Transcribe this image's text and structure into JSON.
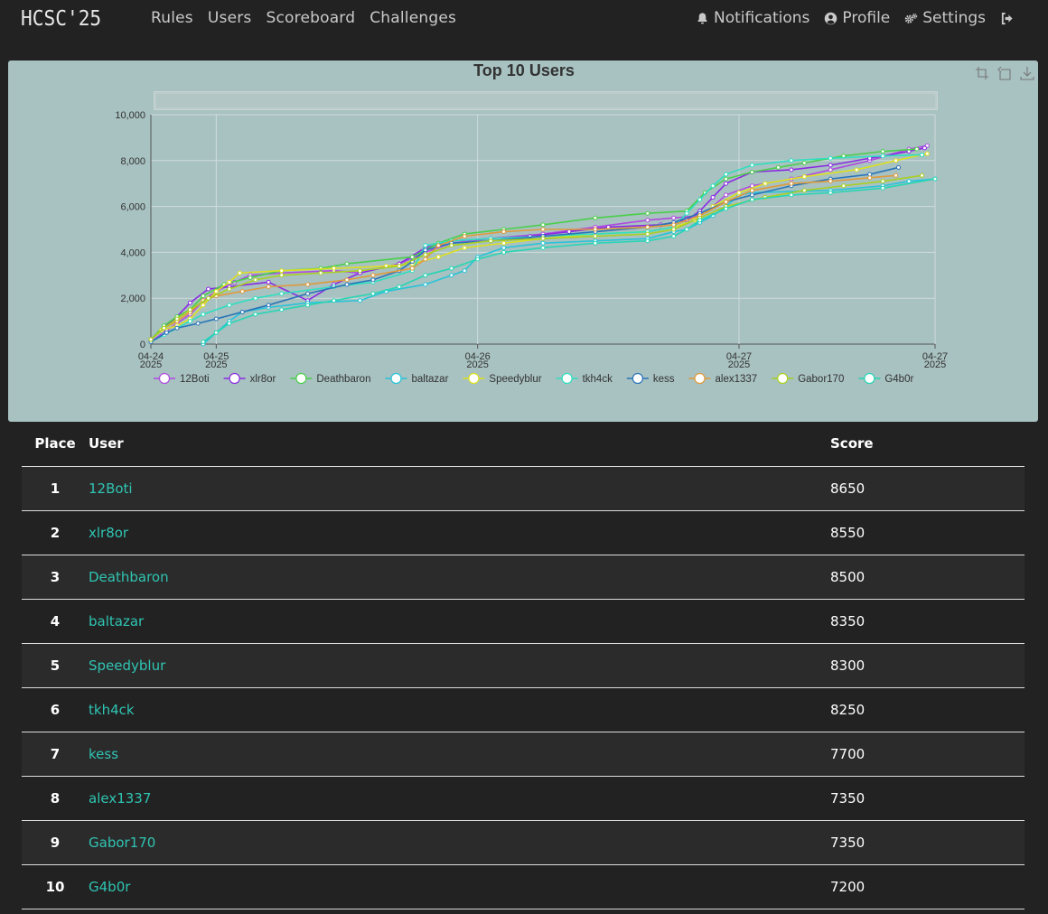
{
  "nav": {
    "brand": "HCSC'25",
    "links": [
      "Rules",
      "Users",
      "Scoreboard",
      "Challenges"
    ],
    "notifications": "Notifications",
    "profile": "Profile",
    "settings": "Settings"
  },
  "colors": {
    "accent": "#2fc4b2",
    "chart_bg": "#a8c1c1",
    "page_bg": "#222222"
  },
  "chart_data": {
    "type": "line",
    "title": "Top 10 Users",
    "y_ticks": [
      "0",
      "2,000",
      "4,000",
      "6,000",
      "8,000",
      "10,000"
    ],
    "ylim": [
      0,
      10000
    ],
    "x_ticks": [
      {
        "label": "04-24",
        "sub": "2025",
        "t": 0
      },
      {
        "label": "04-25",
        "sub": "2025",
        "t": 0.25
      },
      {
        "label": "04-26",
        "sub": "2025",
        "t": 1.25
      },
      {
        "label": "04-27",
        "sub": "2025",
        "t": 2.25
      },
      {
        "label": "04-27",
        "sub": "2025",
        "t": 3.0
      }
    ],
    "series": [
      {
        "name": "12Boti",
        "color": "#b04be0",
        "points": [
          [
            0,
            100
          ],
          [
            0.06,
            600
          ],
          [
            0.1,
            900
          ],
          [
            0.15,
            1300
          ],
          [
            0.2,
            1900
          ],
          [
            0.25,
            2300
          ],
          [
            0.32,
            2700
          ],
          [
            0.38,
            3000
          ],
          [
            0.5,
            3100
          ],
          [
            0.7,
            3200
          ],
          [
            0.8,
            3100
          ],
          [
            0.95,
            3500
          ],
          [
            1.05,
            4000
          ],
          [
            1.15,
            4400
          ],
          [
            1.3,
            4600
          ],
          [
            1.5,
            4800
          ],
          [
            1.7,
            5100
          ],
          [
            1.9,
            5400
          ],
          [
            2.0,
            5500
          ],
          [
            2.1,
            5600
          ],
          [
            2.15,
            6000
          ],
          [
            2.2,
            6500
          ],
          [
            2.3,
            6900
          ],
          [
            2.45,
            7200
          ],
          [
            2.6,
            7600
          ],
          [
            2.75,
            8000
          ],
          [
            2.9,
            8500
          ],
          [
            2.97,
            8650
          ]
        ]
      },
      {
        "name": "xlr8or",
        "color": "#8a2be2",
        "points": [
          [
            0,
            200
          ],
          [
            0.05,
            700
          ],
          [
            0.1,
            1200
          ],
          [
            0.15,
            1800
          ],
          [
            0.22,
            2400
          ],
          [
            0.3,
            2500
          ],
          [
            0.45,
            2700
          ],
          [
            0.6,
            1900
          ],
          [
            0.7,
            2600
          ],
          [
            0.8,
            3100
          ],
          [
            0.95,
            3500
          ],
          [
            1.05,
            4200
          ],
          [
            1.15,
            4500
          ],
          [
            1.3,
            4600
          ],
          [
            1.45,
            4700
          ],
          [
            1.6,
            4900
          ],
          [
            1.75,
            5100
          ],
          [
            1.95,
            5200
          ],
          [
            2.05,
            5400
          ],
          [
            2.1,
            5800
          ],
          [
            2.15,
            6400
          ],
          [
            2.2,
            7000
          ],
          [
            2.3,
            7500
          ],
          [
            2.45,
            7600
          ],
          [
            2.6,
            7800
          ],
          [
            2.75,
            8100
          ],
          [
            2.9,
            8400
          ],
          [
            2.96,
            8550
          ]
        ]
      },
      {
        "name": "Deathbaron",
        "color": "#4bcf4b",
        "points": [
          [
            0,
            200
          ],
          [
            0.05,
            800
          ],
          [
            0.1,
            1200
          ],
          [
            0.15,
            1500
          ],
          [
            0.2,
            2100
          ],
          [
            0.28,
            2600
          ],
          [
            0.38,
            2900
          ],
          [
            0.5,
            3200
          ],
          [
            0.65,
            3300
          ],
          [
            0.75,
            3500
          ],
          [
            1.0,
            3800
          ],
          [
            1.1,
            4400
          ],
          [
            1.2,
            4800
          ],
          [
            1.35,
            5000
          ],
          [
            1.5,
            5200
          ],
          [
            1.7,
            5500
          ],
          [
            1.9,
            5700
          ],
          [
            2.05,
            5800
          ],
          [
            2.12,
            6600
          ],
          [
            2.2,
            7200
          ],
          [
            2.3,
            7500
          ],
          [
            2.4,
            7700
          ],
          [
            2.5,
            7900
          ],
          [
            2.65,
            8200
          ],
          [
            2.8,
            8400
          ],
          [
            2.93,
            8500
          ]
        ]
      },
      {
        "name": "baltazar",
        "color": "#26c4d8",
        "points": [
          [
            0.2,
            0
          ],
          [
            0.25,
            500
          ],
          [
            0.3,
            1000
          ],
          [
            0.35,
            1400
          ],
          [
            0.45,
            1600
          ],
          [
            0.6,
            1800
          ],
          [
            0.8,
            1900
          ],
          [
            0.9,
            2300
          ],
          [
            1.05,
            2600
          ],
          [
            1.15,
            3000
          ],
          [
            1.2,
            3200
          ],
          [
            1.25,
            3800
          ],
          [
            1.35,
            4200
          ],
          [
            1.5,
            4400
          ],
          [
            1.7,
            4500
          ],
          [
            1.9,
            4600
          ],
          [
            2.0,
            4900
          ],
          [
            2.05,
            5000
          ],
          [
            2.1,
            5300
          ],
          [
            2.15,
            5600
          ],
          [
            2.2,
            6000
          ],
          [
            2.25,
            6500
          ],
          [
            2.3,
            6600
          ],
          [
            2.6,
            6700
          ],
          [
            2.8,
            6900
          ],
          [
            2.9,
            7100
          ],
          [
            3.0,
            7200
          ]
        ]
      },
      {
        "name": "Speedyblur",
        "color": "#dde021",
        "points": [
          [
            0,
            200
          ],
          [
            0.04,
            600
          ],
          [
            0.1,
            800
          ],
          [
            0.15,
            1100
          ],
          [
            0.2,
            1700
          ],
          [
            0.25,
            2300
          ],
          [
            0.3,
            2700
          ],
          [
            0.34,
            3100
          ],
          [
            0.5,
            3200
          ],
          [
            0.7,
            3300
          ],
          [
            0.9,
            3400
          ],
          [
            1.0,
            3500
          ],
          [
            1.1,
            3800
          ],
          [
            1.2,
            4200
          ],
          [
            1.35,
            4400
          ],
          [
            1.5,
            4600
          ],
          [
            1.7,
            4800
          ],
          [
            1.9,
            4900
          ],
          [
            2.0,
            5100
          ],
          [
            2.08,
            5400
          ],
          [
            2.15,
            6000
          ],
          [
            2.25,
            6600
          ],
          [
            2.35,
            7000
          ],
          [
            2.5,
            7300
          ],
          [
            2.7,
            7600
          ],
          [
            2.85,
            8000
          ],
          [
            2.97,
            8300
          ]
        ]
      },
      {
        "name": "tkh4ck",
        "color": "#2de0c0",
        "points": [
          [
            0,
            100
          ],
          [
            0.05,
            400
          ],
          [
            0.1,
            700
          ],
          [
            0.15,
            1000
          ],
          [
            0.2,
            1300
          ],
          [
            0.3,
            1700
          ],
          [
            0.4,
            2000
          ],
          [
            0.5,
            2200
          ],
          [
            0.7,
            2500
          ],
          [
            0.85,
            2700
          ],
          [
            1.0,
            3200
          ],
          [
            1.05,
            4300
          ],
          [
            1.15,
            4500
          ],
          [
            1.3,
            4600
          ],
          [
            1.5,
            4700
          ],
          [
            1.7,
            4800
          ],
          [
            1.9,
            4900
          ],
          [
            2.0,
            5100
          ],
          [
            2.05,
            5700
          ],
          [
            2.1,
            6300
          ],
          [
            2.15,
            6900
          ],
          [
            2.2,
            7400
          ],
          [
            2.3,
            7800
          ],
          [
            2.45,
            8000
          ],
          [
            2.6,
            8100
          ],
          [
            2.8,
            8200
          ],
          [
            2.95,
            8250
          ]
        ]
      },
      {
        "name": "kess",
        "color": "#2a74b8",
        "points": [
          [
            0,
            100
          ],
          [
            0.06,
            500
          ],
          [
            0.1,
            700
          ],
          [
            0.18,
            900
          ],
          [
            0.25,
            1100
          ],
          [
            0.35,
            1400
          ],
          [
            0.45,
            1700
          ],
          [
            0.6,
            2200
          ],
          [
            0.75,
            2600
          ],
          [
            0.85,
            2800
          ],
          [
            0.95,
            3200
          ],
          [
            1.0,
            3600
          ],
          [
            1.05,
            4100
          ],
          [
            1.15,
            4400
          ],
          [
            1.3,
            4500
          ],
          [
            1.5,
            4700
          ],
          [
            1.7,
            4900
          ],
          [
            1.9,
            5100
          ],
          [
            2.0,
            5300
          ],
          [
            2.1,
            5700
          ],
          [
            2.2,
            6200
          ],
          [
            2.3,
            6500
          ],
          [
            2.45,
            6900
          ],
          [
            2.6,
            7200
          ],
          [
            2.75,
            7400
          ],
          [
            2.86,
            7700
          ]
        ]
      },
      {
        "name": "alex1337",
        "color": "#e09a3a",
        "points": [
          [
            0,
            200
          ],
          [
            0.05,
            700
          ],
          [
            0.1,
            1000
          ],
          [
            0.15,
            1400
          ],
          [
            0.2,
            1900
          ],
          [
            0.25,
            2100
          ],
          [
            0.35,
            2300
          ],
          [
            0.45,
            2500
          ],
          [
            0.6,
            2600
          ],
          [
            0.75,
            2800
          ],
          [
            0.85,
            3000
          ],
          [
            1.0,
            3300
          ],
          [
            1.05,
            3700
          ],
          [
            1.1,
            4300
          ],
          [
            1.2,
            4700
          ],
          [
            1.35,
            4900
          ],
          [
            1.5,
            5000
          ],
          [
            1.7,
            5000
          ],
          [
            1.9,
            5100
          ],
          [
            2.0,
            5200
          ],
          [
            2.1,
            5600
          ],
          [
            2.2,
            6200
          ],
          [
            2.3,
            6700
          ],
          [
            2.45,
            7000
          ],
          [
            2.6,
            7100
          ],
          [
            2.75,
            7250
          ],
          [
            2.85,
            7350
          ]
        ]
      },
      {
        "name": "Gabor170",
        "color": "#a8d020",
        "points": [
          [
            0,
            200
          ],
          [
            0.05,
            700
          ],
          [
            0.1,
            1100
          ],
          [
            0.15,
            1500
          ],
          [
            0.22,
            2000
          ],
          [
            0.3,
            2400
          ],
          [
            0.4,
            2800
          ],
          [
            0.5,
            3000
          ],
          [
            0.65,
            3100
          ],
          [
            0.8,
            3200
          ],
          [
            0.95,
            3400
          ],
          [
            1.05,
            3900
          ],
          [
            1.15,
            4300
          ],
          [
            1.3,
            4500
          ],
          [
            1.5,
            4600
          ],
          [
            1.7,
            4700
          ],
          [
            1.9,
            4800
          ],
          [
            2.0,
            5000
          ],
          [
            2.1,
            5500
          ],
          [
            2.2,
            6000
          ],
          [
            2.35,
            6400
          ],
          [
            2.5,
            6700
          ],
          [
            2.65,
            6900
          ],
          [
            2.8,
            7100
          ],
          [
            2.95,
            7350
          ]
        ]
      },
      {
        "name": "G4b0r",
        "color": "#26d6b4",
        "points": [
          [
            0.2,
            100
          ],
          [
            0.25,
            500
          ],
          [
            0.3,
            900
          ],
          [
            0.4,
            1300
          ],
          [
            0.5,
            1500
          ],
          [
            0.6,
            1700
          ],
          [
            0.7,
            1900
          ],
          [
            0.85,
            2200
          ],
          [
            0.95,
            2500
          ],
          [
            1.05,
            3000
          ],
          [
            1.15,
            3300
          ],
          [
            1.25,
            3700
          ],
          [
            1.35,
            4000
          ],
          [
            1.5,
            4200
          ],
          [
            1.7,
            4400
          ],
          [
            1.9,
            4500
          ],
          [
            2.0,
            4700
          ],
          [
            2.05,
            5000
          ],
          [
            2.1,
            5400
          ],
          [
            2.2,
            5900
          ],
          [
            2.3,
            6300
          ],
          [
            2.45,
            6500
          ],
          [
            2.6,
            6600
          ],
          [
            2.8,
            6800
          ],
          [
            3.0,
            7200
          ]
        ]
      }
    ]
  },
  "table": {
    "headers": {
      "place": "Place",
      "user": "User",
      "score": "Score"
    },
    "rows": [
      {
        "place": "1",
        "user": "12Boti",
        "score": "8650"
      },
      {
        "place": "2",
        "user": "xlr8or",
        "score": "8550"
      },
      {
        "place": "3",
        "user": "Deathbaron",
        "score": "8500"
      },
      {
        "place": "4",
        "user": "baltazar",
        "score": "8350"
      },
      {
        "place": "5",
        "user": "Speedyblur",
        "score": "8300"
      },
      {
        "place": "6",
        "user": "tkh4ck",
        "score": "8250"
      },
      {
        "place": "7",
        "user": "kess",
        "score": "7700"
      },
      {
        "place": "8",
        "user": "alex1337",
        "score": "7350"
      },
      {
        "place": "9",
        "user": "Gabor170",
        "score": "7350"
      },
      {
        "place": "10",
        "user": "G4b0r",
        "score": "7200"
      }
    ]
  }
}
